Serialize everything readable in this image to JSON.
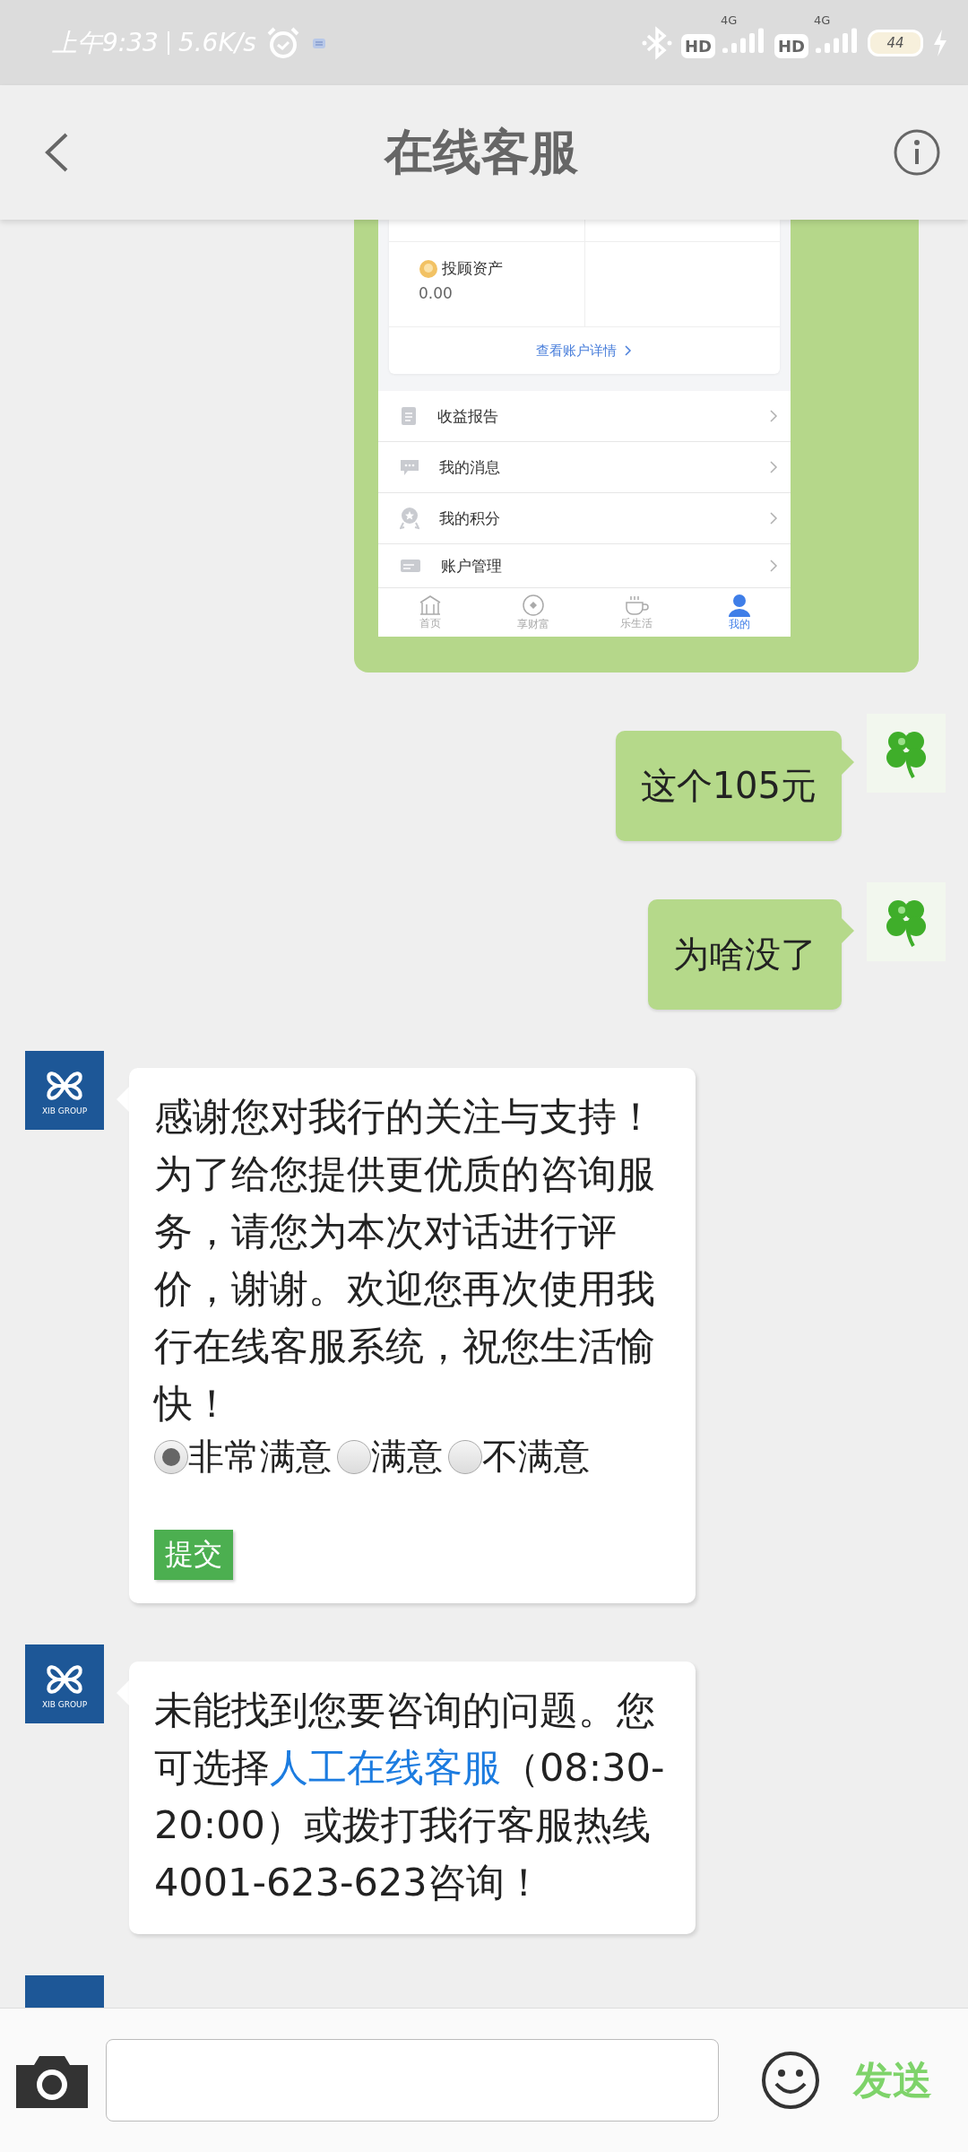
{
  "status_bar": {
    "time": "上午9:33",
    "speed": "5.6K/s",
    "networks": [
      {
        "badge": "HD",
        "type": "4G"
      },
      {
        "badge": "HD",
        "type": "4G"
      }
    ],
    "battery": "44"
  },
  "header": {
    "title": "在线客服"
  },
  "messages": [
    {
      "kind": "screenshot",
      "from_user": true,
      "asset": {
        "label": "投顾资产",
        "value": "0.00"
      },
      "detail_link": "查看账户详情",
      "menu": [
        "收益报告",
        "我的消息",
        "我的积分",
        "账户管理"
      ],
      "tabs": [
        {
          "label": "首页",
          "selected": false
        },
        {
          "label": "享财富",
          "selected": false
        },
        {
          "label": "乐生活",
          "selected": false
        },
        {
          "label": "我的",
          "selected": true
        }
      ]
    },
    {
      "kind": "text",
      "from_user": true,
      "text": "这个105元"
    },
    {
      "kind": "text",
      "from_user": true,
      "text": "为啥没了"
    },
    {
      "kind": "rating",
      "from_user": false,
      "avatar_text": "XIB GROUP",
      "text": "感谢您对我行的关注与支持！为了给您提供更优质的咨询服务，请您为本次对话进行评价，谢谢。欢迎您再次使用我行在线客服系统，祝您生活愉快！",
      "options": [
        {
          "label": "非常满意",
          "selected": true
        },
        {
          "label": "满意",
          "selected": false
        },
        {
          "label": "不满意",
          "selected": false
        }
      ],
      "submit": "提交"
    },
    {
      "kind": "link-text",
      "from_user": false,
      "avatar_text": "XIB GROUP",
      "before": "未能找到您要咨询的问题。您可选择",
      "link": "人工在线客服",
      "after": "（08:30-20:00）或拨打我行客服热线4001-623-623咨询！"
    },
    {
      "kind": "partial",
      "from_user": false
    }
  ],
  "composer": {
    "send": "发送"
  }
}
